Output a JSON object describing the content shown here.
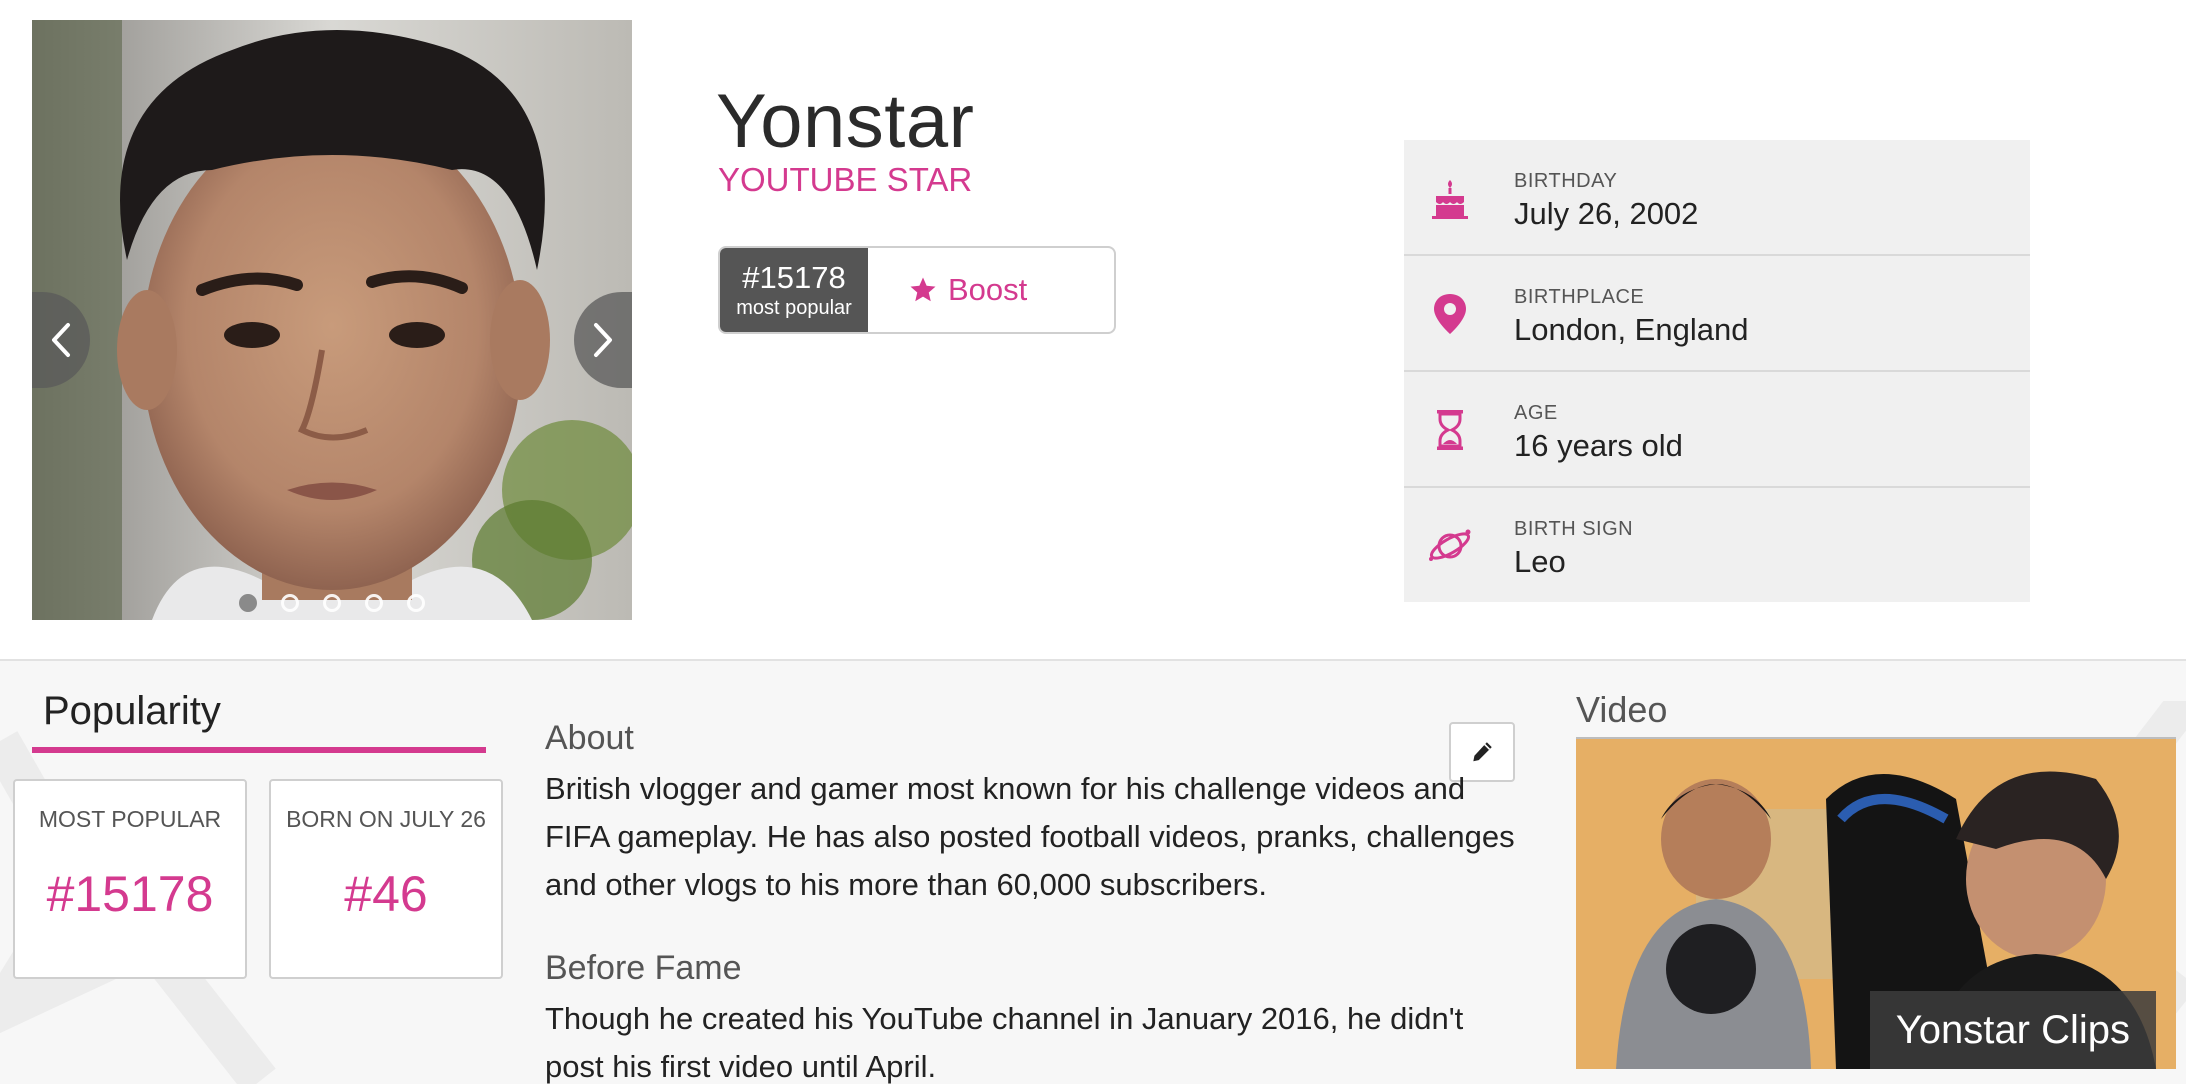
{
  "profile": {
    "name": "Yonstar",
    "profession": "YOUTUBE STAR",
    "rank_number": "#15178",
    "rank_caption": "most popular",
    "boost_label": "Boost"
  },
  "carousel": {
    "slide_count": 5,
    "active_slide": 1
  },
  "info": [
    {
      "label": "BIRTHDAY",
      "value": "July 26, 2002",
      "icon": "birthday-cake-icon"
    },
    {
      "label": "BIRTHPLACE",
      "value": "London, England",
      "icon": "map-pin-icon"
    },
    {
      "label": "AGE",
      "value": "16 years old",
      "icon": "hourglass-icon"
    },
    {
      "label": "BIRTH SIGN",
      "value": "Leo",
      "icon": "planet-icon"
    }
  ],
  "popularity": {
    "title": "Popularity",
    "cards": [
      {
        "label": "MOST POPULAR",
        "value": "#15178"
      },
      {
        "label": "BORN ON JULY 26",
        "value": "#46"
      }
    ]
  },
  "about": {
    "heading": "About",
    "text": "British vlogger and gamer most known for his challenge videos and FIFA gameplay. He has also posted football videos, pranks, challenges and other vlogs to his more than 60,000 subscribers."
  },
  "before_fame": {
    "heading": "Before Fame",
    "text": "Though he created his YouTube channel in January 2016, he didn't post his first video until April."
  },
  "video": {
    "heading": "Video",
    "caption": "Yonstar Clips"
  },
  "colors": {
    "accent": "#d43a8f",
    "rank_bg": "#555555",
    "panel_bg": "#f0f0f0"
  }
}
